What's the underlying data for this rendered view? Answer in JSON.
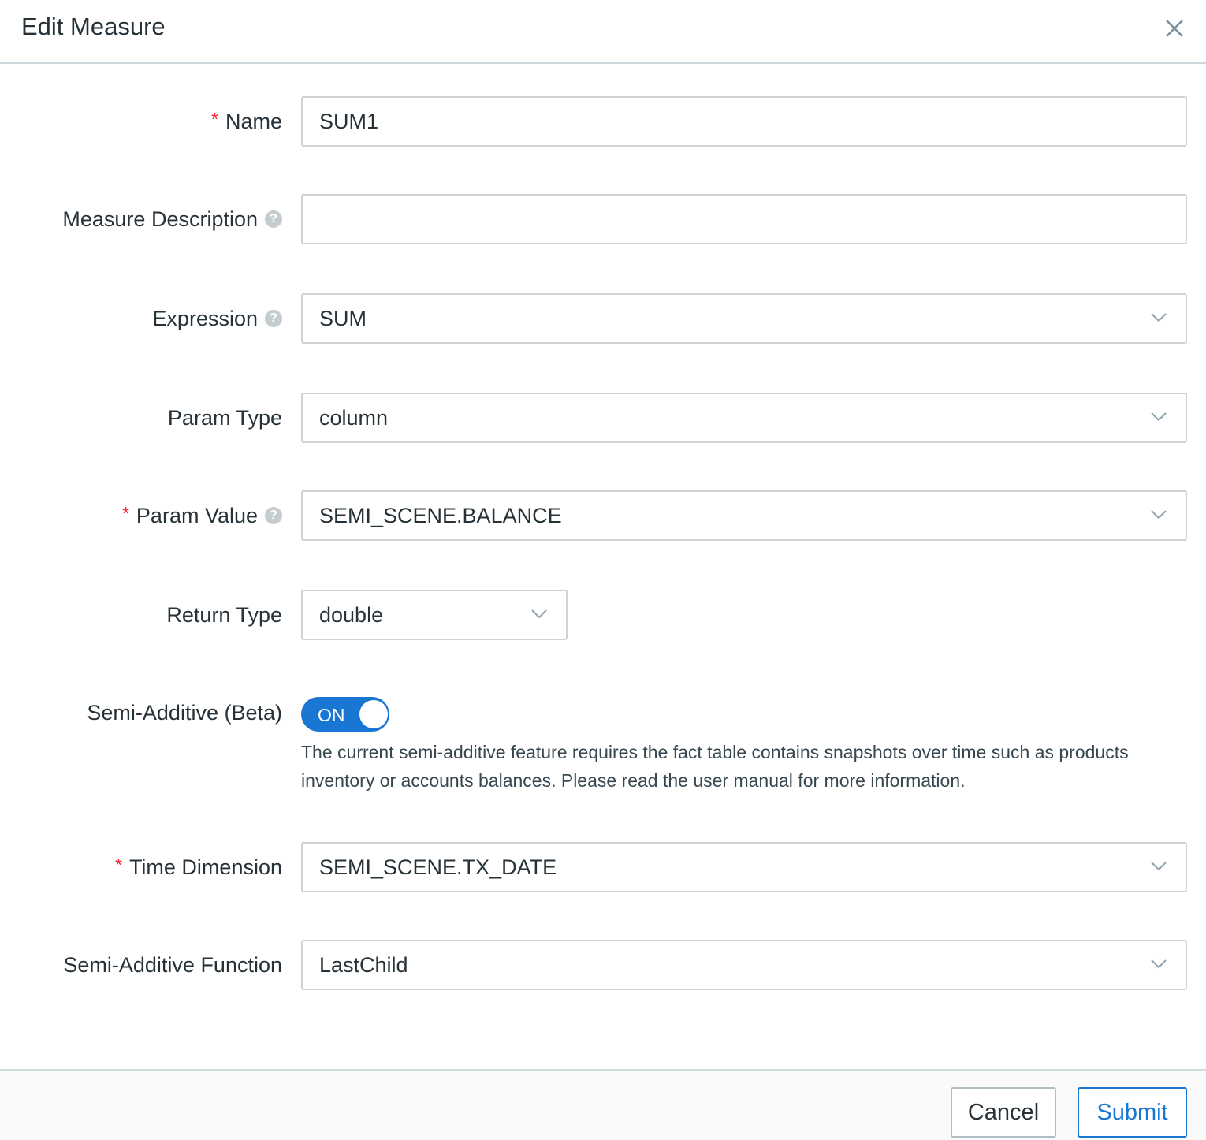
{
  "dialog": {
    "title": "Edit Measure",
    "close_icon": "close-icon"
  },
  "form": {
    "name": {
      "label": "Name",
      "required": true,
      "value": "SUM1"
    },
    "measure_description": {
      "label": "Measure Description",
      "value": "",
      "help_icon": "question-icon"
    },
    "expression": {
      "label": "Expression",
      "value": "SUM",
      "help_icon": "question-icon"
    },
    "param_type": {
      "label": "Param Type",
      "value": "column"
    },
    "param_value": {
      "label": "Param Value",
      "required": true,
      "value": "SEMI_SCENE.BALANCE",
      "help_icon": "question-icon"
    },
    "return_type": {
      "label": "Return Type",
      "value": "double"
    },
    "semi_additive": {
      "label": "Semi-Additive (Beta)",
      "toggle_text": "ON",
      "enabled": true,
      "hint": "The current semi-additive feature requires the fact table contains snapshots over time such as products inventory or accounts balances. Please read the user manual for more information."
    },
    "time_dimension": {
      "label": "Time Dimension",
      "required": true,
      "value": "SEMI_SCENE.TX_DATE"
    },
    "semi_additive_function": {
      "label": "Semi-Additive Function",
      "value": "LastChild"
    }
  },
  "footer": {
    "cancel_label": "Cancel",
    "submit_label": "Submit"
  },
  "colors": {
    "accent": "#1976d2",
    "required": "#f5222d",
    "border": "#cdd3d6",
    "text": "#263238"
  },
  "symbols": {
    "required_mark": "*",
    "help_mark": "?"
  }
}
